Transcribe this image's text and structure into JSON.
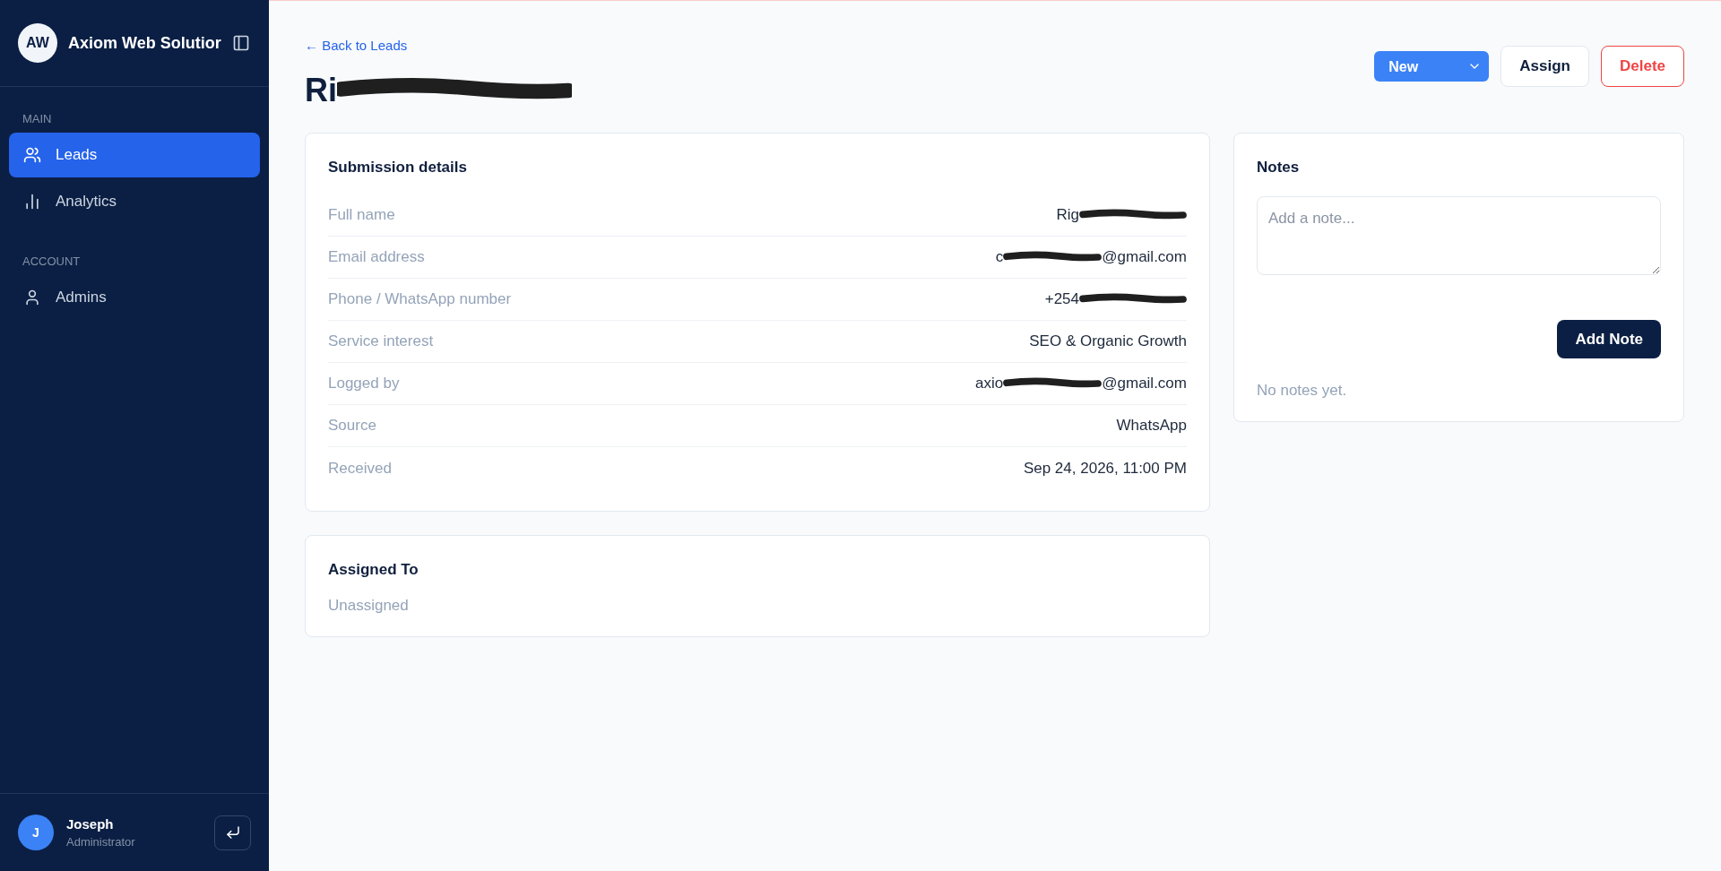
{
  "sidebar": {
    "logo": "AW",
    "brand": "Axiom Web Solutior",
    "sections": [
      {
        "label": "MAIN",
        "items": [
          {
            "label": "Leads",
            "selected": true
          },
          {
            "label": "Analytics",
            "selected": false
          }
        ]
      },
      {
        "label": "ACCOUNT",
        "items": [
          {
            "label": "Admins",
            "selected": false
          }
        ]
      }
    ],
    "user": {
      "initial": "J",
      "name": "Joseph",
      "role": "Administrator"
    }
  },
  "header": {
    "back_link": "← Back to Leads",
    "title": {
      "before": "Ri",
      "redacted": true
    },
    "status": "New",
    "actions": [
      {
        "label": "Assign",
        "kind": "default"
      },
      {
        "label": "Delete",
        "kind": "danger"
      }
    ]
  },
  "submission_details": {
    "title": "Submission details",
    "rows": [
      {
        "label": "Full name",
        "before": "Rig",
        "redacted": true
      },
      {
        "label": "Email address",
        "before": "c",
        "after": "@gmail.com",
        "redacted": true
      },
      {
        "label": "Phone / WhatsApp number",
        "before": "+254",
        "redacted": true
      },
      {
        "label": "Service interest",
        "before": "SEO & Organic Growth",
        "redacted": false
      },
      {
        "label": "Logged by",
        "before": "axio",
        "after": "@gmail.com",
        "redacted": true
      },
      {
        "label": "Source",
        "before": "WhatsApp",
        "redacted": false
      },
      {
        "label": "Received",
        "before": "Sep 24, 2026, 11:00 PM",
        "redacted": false
      }
    ]
  },
  "assigned": {
    "title": "Assigned To",
    "value": "Unassigned"
  },
  "notes": {
    "title": "Notes",
    "placeholder": "Add a note...",
    "button": "Add Note",
    "empty": "No notes yet."
  }
}
